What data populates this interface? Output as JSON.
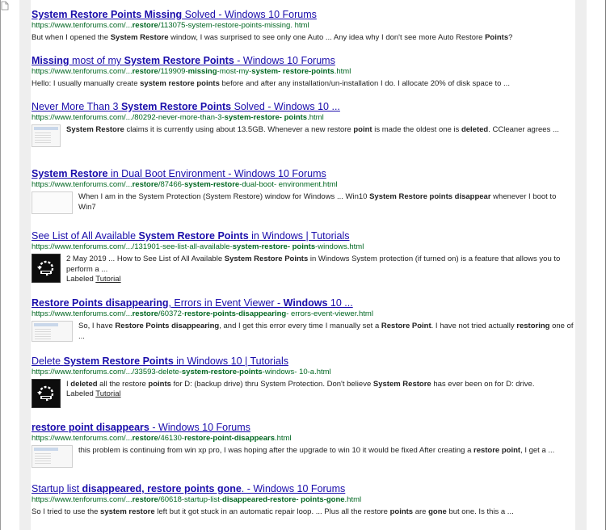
{
  "results": [
    {
      "title": [
        {
          "t": "System Restore Points Missing",
          "b": true
        },
        {
          "t": " Solved - Windows 10 Forums",
          "b": false
        }
      ],
      "url": [
        {
          "t": "https://www.tenforums.com/...",
          "b": false
        },
        {
          "t": "restore",
          "b": true
        },
        {
          "t": "/113075-system-restore-points-missing. html",
          "b": false
        }
      ],
      "thumb": "none",
      "snippet": [
        {
          "t": "But when I opened the ",
          "b": false
        },
        {
          "t": "System Restore",
          "b": true
        },
        {
          "t": " window, I was surprised to see only one Auto ... Any idea why I don't see more Auto Restore ",
          "b": false
        },
        {
          "t": "Points",
          "b": true
        },
        {
          "t": "?",
          "b": false
        }
      ]
    },
    {
      "title": [
        {
          "t": "Missing",
          "b": true
        },
        {
          "t": " most of my ",
          "b": false
        },
        {
          "t": "System Restore Points",
          "b": true
        },
        {
          "t": " - Windows 10 Forums",
          "b": false
        }
      ],
      "url": [
        {
          "t": "https://www.tenforums.com/...",
          "b": false
        },
        {
          "t": "restore",
          "b": true
        },
        {
          "t": "/119909-",
          "b": false
        },
        {
          "t": "missing",
          "b": true
        },
        {
          "t": "-most-my-",
          "b": false
        },
        {
          "t": "system- restore-points",
          "b": true
        },
        {
          "t": ".html",
          "b": false
        }
      ],
      "thumb": "none",
      "snippet": [
        {
          "t": "Hello: I usually manually create ",
          "b": false
        },
        {
          "t": "system restore points",
          "b": true
        },
        {
          "t": " before and after any installation/un-installation I do. I allocate 20% of disk space to ...",
          "b": false
        }
      ]
    },
    {
      "title": [
        {
          "t": "Never More Than 3 ",
          "b": false
        },
        {
          "t": "System Restore Points",
          "b": true
        },
        {
          "t": " Solved - Windows 10 ...",
          "b": false
        }
      ],
      "url": [
        {
          "t": "https://www.tenforums.com/...",
          "b": false
        },
        {
          "t": "/80292-never-more-than-3-",
          "b": false
        },
        {
          "t": "system-restore- points",
          "b": true
        },
        {
          "t": ".html",
          "b": false
        }
      ],
      "thumb": "shot",
      "snippet": [
        {
          "t": "System Restore",
          "b": true
        },
        {
          "t": " claims it is currently using about 13.5GB. Whenever a new restore ",
          "b": false
        },
        {
          "t": "point",
          "b": true
        },
        {
          "t": " is made the oldest one is ",
          "b": false
        },
        {
          "t": "deleted",
          "b": true
        },
        {
          "t": ". CCleaner agrees ...",
          "b": false
        }
      ]
    },
    {
      "title": [
        {
          "t": "System Restore",
          "b": true
        },
        {
          "t": " in Dual Boot Environment - Windows 10 Forums",
          "b": false
        }
      ],
      "url": [
        {
          "t": "https://www.tenforums.com/...",
          "b": false
        },
        {
          "t": "restore",
          "b": true
        },
        {
          "t": "/87466-",
          "b": false
        },
        {
          "t": "system-restore",
          "b": true
        },
        {
          "t": "-dual-boot- environment.html",
          "b": false
        }
      ],
      "thumb": "blank",
      "snippet": [
        {
          "t": "When I am in the System Protection (System Restore) window for Windows ... Win10 ",
          "b": false
        },
        {
          "t": "System Restore points disappear",
          "b": true
        },
        {
          "t": " whenever I boot to Win7",
          "b": false
        }
      ]
    },
    {
      "title": [
        {
          "t": "See List of All Available ",
          "b": false
        },
        {
          "t": "System Restore Points",
          "b": true
        },
        {
          "t": " in Windows | Tutorials",
          "b": false
        }
      ],
      "url": [
        {
          "t": "https://www.tenforums.com/...",
          "b": false
        },
        {
          "t": "/131901-see-list-all-available-",
          "b": false
        },
        {
          "t": "system-restore- points",
          "b": true
        },
        {
          "t": "-windows.html",
          "b": false
        }
      ],
      "thumb": "dark",
      "snippet": [
        {
          "t": "2 May 2019 ... How to See List of All Available ",
          "b": false
        },
        {
          "t": "System Restore Points",
          "b": true
        },
        {
          "t": " in Windows System protection (if turned on) is a feature that allows you to perform a ...",
          "b": false
        }
      ],
      "labeled": "Labeled",
      "tag": "Tutorial"
    },
    {
      "title": [
        {
          "t": "Restore Points disappearing",
          "b": true
        },
        {
          "t": ", Errors in Event Viewer - ",
          "b": false
        },
        {
          "t": "Windows",
          "b": true
        },
        {
          "t": " 10 ...",
          "b": false
        }
      ],
      "url": [
        {
          "t": "https://www.tenforums.com/...",
          "b": false
        },
        {
          "t": "restore",
          "b": true
        },
        {
          "t": "/60372-",
          "b": false
        },
        {
          "t": "restore-points-disappearing",
          "b": true
        },
        {
          "t": "- errors-event-viewer.html",
          "b": false
        }
      ],
      "thumb": "shot",
      "snippet": [
        {
          "t": "So, I have ",
          "b": false
        },
        {
          "t": "Restore Points disappearing",
          "b": true
        },
        {
          "t": ", and I get this error every time I manually set a ",
          "b": false
        },
        {
          "t": "Restore Point",
          "b": true
        },
        {
          "t": ". I have not tried actually ",
          "b": false
        },
        {
          "t": "restoring",
          "b": true
        },
        {
          "t": " one of ...",
          "b": false
        }
      ]
    },
    {
      "title": [
        {
          "t": "Delete ",
          "b": false
        },
        {
          "t": "System Restore Points",
          "b": true
        },
        {
          "t": " in Windows 10 | Tutorials",
          "b": false
        }
      ],
      "url": [
        {
          "t": "https://www.tenforums.com/...",
          "b": false
        },
        {
          "t": "/33593-delete-",
          "b": false
        },
        {
          "t": "system-restore-points",
          "b": true
        },
        {
          "t": "-windows- 10-a.html",
          "b": false
        }
      ],
      "thumb": "dark",
      "snippet": [
        {
          "t": "I ",
          "b": false
        },
        {
          "t": "deleted",
          "b": true
        },
        {
          "t": " all the restore ",
          "b": false
        },
        {
          "t": "points",
          "b": true
        },
        {
          "t": " for D: (backup drive) thru System Protection. Don't believe ",
          "b": false
        },
        {
          "t": "System Restore",
          "b": true
        },
        {
          "t": " has ever been on for D: drive.",
          "b": false
        }
      ],
      "labeled": "Labeled",
      "tag": "Tutorial"
    },
    {
      "title": [
        {
          "t": "restore point disappears",
          "b": true
        },
        {
          "t": " - Windows 10 Forums",
          "b": false
        }
      ],
      "url": [
        {
          "t": "https://www.tenforums.com/...",
          "b": false
        },
        {
          "t": "restore",
          "b": true
        },
        {
          "t": "/46130-",
          "b": false
        },
        {
          "t": "restore-point-disappears",
          "b": true
        },
        {
          "t": ".html",
          "b": false
        }
      ],
      "thumb": "shot",
      "snippet": [
        {
          "t": "this problem is continuing from win xp pro, I was hoping after the upgrade to win 10 it would be fixed After creating a ",
          "b": false
        },
        {
          "t": "restore point",
          "b": true
        },
        {
          "t": ", I get a ...",
          "b": false
        }
      ]
    },
    {
      "title": [
        {
          "t": "Startup list ",
          "b": false
        },
        {
          "t": "disappeared, restore points gone",
          "b": true
        },
        {
          "t": ". - Windows 10 Forums",
          "b": false
        }
      ],
      "url": [
        {
          "t": "https://www.tenforums.com/...",
          "b": false
        },
        {
          "t": "restore",
          "b": true
        },
        {
          "t": "/60618-startup-list-",
          "b": false
        },
        {
          "t": "disappeared-restore- points-gone",
          "b": true
        },
        {
          "t": ".html",
          "b": false
        }
      ],
      "thumb": "none",
      "snippet": [
        {
          "t": "So I tried to use the ",
          "b": false
        },
        {
          "t": "system restore",
          "b": true
        },
        {
          "t": " left but it got stuck in an automatic repair loop. ... Plus all the restore ",
          "b": false
        },
        {
          "t": "points",
          "b": true
        },
        {
          "t": " are ",
          "b": false
        },
        {
          "t": "gone",
          "b": true
        },
        {
          "t": " but one. Is this a ...",
          "b": false
        }
      ]
    }
  ]
}
